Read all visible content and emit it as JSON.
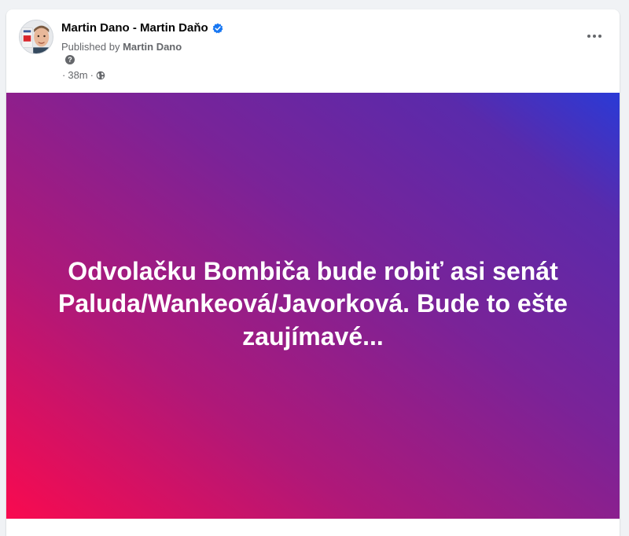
{
  "post": {
    "author_name": "Martin Dano - Martin Daňo",
    "published_prefix": "Published by",
    "published_by": "Martin Dano",
    "help_glyph": "?",
    "time": "38m",
    "meta_separator": "·",
    "privacy_icon": "globe-icon",
    "more_icon": "more-options-icon",
    "text": "Odvolačku Bombiča bude robiť asi senát Paluda/Wankeová/Javorková. Bude to ešte zaujímavé..."
  },
  "colors": {
    "page_bg": "#f0f2f5",
    "card_bg": "#ffffff",
    "verified_blue": "#1877f2",
    "gradient": [
      "#f90a4f",
      "#b01878",
      "#7a2398",
      "#5a2aab",
      "#2a3ad6"
    ],
    "post_text": "#ffffff",
    "secondary_text": "#65676b"
  }
}
